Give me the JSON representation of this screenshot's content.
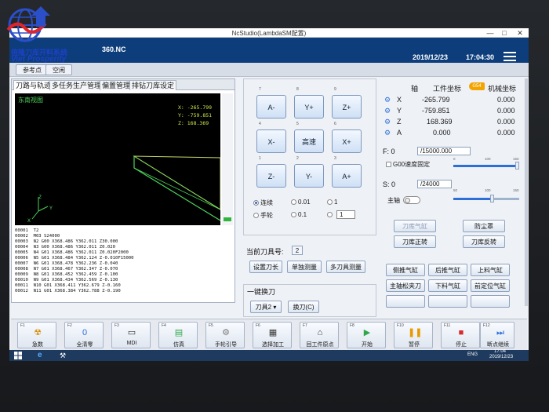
{
  "branding": {
    "name_cn": "倍隆刀库开料系统",
    "name_en": "Viet Prosperity"
  },
  "window": {
    "title": "NcStudio(LambdaSM配置)",
    "min": "—",
    "max": "□",
    "close": "✕"
  },
  "header": {
    "program": "360.NC",
    "date": "2019/12/23",
    "time": "17:04:30"
  },
  "subbar": {
    "ref_point": "参考点",
    "idle": "空闲"
  },
  "tabs": [
    "刀路与轨迹",
    "多任务生产管理",
    "偏置管理",
    "排钻刀库设定"
  ],
  "viewport": {
    "label": "东南视图",
    "coords": [
      {
        "axis": "X:",
        "value": "-265.799"
      },
      {
        "axis": "Y:",
        "value": "-759.851"
      },
      {
        "axis": "Z:",
        "value": "168.369"
      }
    ],
    "axis_labels": {
      "z": "Z",
      "y": "Y",
      "x": "X"
    }
  },
  "gcode": [
    "00001  T2",
    "00002  M03 S24000",
    "00003  N2 G00 X368.486 Y362.011 Z30.000",
    "00004  N3 G00 X368.486 Y362.011 Z0.020",
    "00005  N4 G01 X368.486 Y362.011 Z0.020F2000",
    "00006  N5 G01 X368.484 Y362.124 Z-0.010F15000",
    "00007  N6 G01 X368.478 Y362.236 Z-0.040",
    "00008  N7 G01 X368.467 Y362.347 Z-0.070",
    "00009  N8 G01 X368.452 Y362.459 Z-0.100",
    "00010  N9 G01 X368.434 Y362.569 Z-0.130",
    "00011  N10 G01 X368.411 Y362.679 Z-0.160",
    "00012  N11 G01 X368.384 Y362.788 Z-0.190"
  ],
  "jog": {
    "buttons": [
      {
        "num": "7",
        "label": "A-"
      },
      {
        "num": "8",
        "label": "Y+"
      },
      {
        "num": "9",
        "label": "Z+"
      },
      {
        "num": "4",
        "label": "X-"
      },
      {
        "num": "5",
        "label": "高速"
      },
      {
        "num": "6",
        "label": "X+"
      },
      {
        "num": "1",
        "label": "Z-"
      },
      {
        "num": "2",
        "label": "Y-"
      },
      {
        "num": "3",
        "label": "A+"
      }
    ],
    "modes": {
      "continuous": "连续",
      "handwheel": "手轮"
    },
    "steps": [
      "0.01",
      "1",
      "0.1",
      "1"
    ]
  },
  "tool": {
    "current_label": "当前刀具号:",
    "current_value": "2",
    "set_length": "设置刀长",
    "single_measure": "单独测量",
    "multi_measure": "多刀具测量",
    "onekey_label": "一键换刀",
    "tool_select": "刀具2",
    "change_button": "换刀(C)"
  },
  "coords": {
    "headers": {
      "axis": "轴",
      "work": "工件坐标",
      "machine": "机械坐标"
    },
    "badge": "G54",
    "rows": [
      {
        "axis": "X",
        "work": "-265.799",
        "machine": "0.000"
      },
      {
        "axis": "Y",
        "work": "-759.851",
        "machine": "0.000"
      },
      {
        "axis": "Z",
        "work": "168.369",
        "machine": "0.000"
      },
      {
        "axis": "A",
        "work": "0.000",
        "machine": "0.000"
      }
    ]
  },
  "feed": {
    "label": "F: 0",
    "value": "/15000.000",
    "g00_label": "G00速度固定",
    "ticks": [
      "0",
      "100",
      "150"
    ],
    "ratio": 0.98
  },
  "spindle": {
    "label": "S: 0",
    "value": "/24000",
    "main_label": "主轴",
    "ticks": [
      "50",
      "100",
      "150"
    ],
    "ratio": 0.6
  },
  "panel_buttons": [
    {
      "label": "刀库气缸",
      "state": "disabled"
    },
    {
      "label": "防尘罩",
      "state": "enabled"
    },
    {
      "label": "刀库正转",
      "state": "enabled"
    },
    {
      "label": "刀库反转",
      "state": "enabled"
    },
    {
      "label": "侧推气缸",
      "state": "enabled"
    },
    {
      "label": "后推气缸",
      "state": "enabled"
    },
    {
      "label": "上料气缸",
      "state": "enabled"
    },
    {
      "label": "主轴松夹刀",
      "state": "enabled"
    },
    {
      "label": "下料气缸",
      "state": "enabled"
    },
    {
      "label": "前定位气缸",
      "state": "enabled"
    },
    {
      "label": "",
      "state": "enabled"
    },
    {
      "label": "",
      "state": "enabled"
    },
    {
      "label": "",
      "state": "enabled"
    }
  ],
  "function_keys": [
    {
      "fn": "F1",
      "label": "急数",
      "icon": "emergency-icon",
      "color": "#d98c00"
    },
    {
      "fn": "F2",
      "label": "全清零",
      "icon": "zero-icon",
      "color": "#2d6fd6"
    },
    {
      "fn": "F3",
      "label": "MDI",
      "icon": "mdi-icon",
      "color": "#333333"
    },
    {
      "fn": "F4",
      "label": "仿真",
      "icon": "simulate-icon",
      "color": "#2fa84a"
    },
    {
      "fn": "F5",
      "label": "手轮引导",
      "icon": "handwheel-icon",
      "color": "#777777"
    },
    {
      "fn": "F6",
      "label": "选择加工",
      "icon": "select-process-icon",
      "color": "#333333"
    },
    {
      "fn": "F7",
      "label": "回工件原点",
      "icon": "home-icon",
      "color": "#333333"
    },
    {
      "fn": "F8",
      "label": "开始",
      "icon": "play-icon",
      "color": "#2fa84a"
    },
    {
      "fn": "F10",
      "label": "暂停",
      "icon": "pause-icon",
      "color": "#e89a00"
    },
    {
      "fn": "F11",
      "label": "停止",
      "icon": "stop-icon",
      "color": "#d62a2a"
    },
    {
      "fn": "F12",
      "label": "断点继续",
      "icon": "resume-icon",
      "color": "#2d6fd6"
    }
  ],
  "taskbar": {
    "time": "17:04",
    "date": "2019/12/23",
    "lang": "ENG"
  }
}
